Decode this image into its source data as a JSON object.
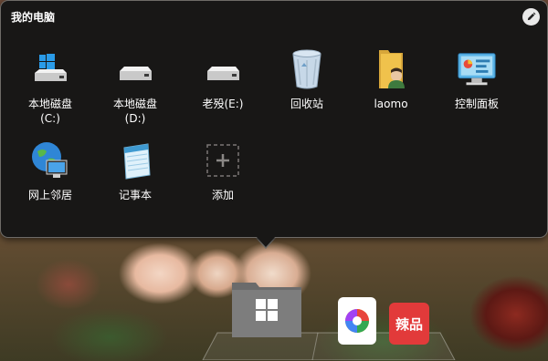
{
  "panel": {
    "title": "我的电脑",
    "edit_icon": "pencil-icon"
  },
  "items": [
    {
      "id": "drive-c",
      "label": "本地磁盘",
      "sublabel": "(C:)",
      "icon": "windows-drive-icon"
    },
    {
      "id": "drive-d",
      "label": "本地磁盘",
      "sublabel": "(D:)",
      "icon": "drive-icon"
    },
    {
      "id": "drive-e",
      "label": "老殁(E:)",
      "sublabel": "",
      "icon": "drive-icon"
    },
    {
      "id": "recycle-bin",
      "label": "回收站",
      "sublabel": "",
      "icon": "recycle-bin-icon"
    },
    {
      "id": "laomo",
      "label": "laomo",
      "sublabel": "",
      "icon": "user-folder-icon"
    },
    {
      "id": "control-panel",
      "label": "控制面板",
      "sublabel": "",
      "icon": "control-panel-icon"
    },
    {
      "id": "network",
      "label": "网上邻居",
      "sublabel": "",
      "icon": "network-globe-icon"
    },
    {
      "id": "notepad",
      "label": "记事本",
      "sublabel": "",
      "icon": "notepad-icon"
    },
    {
      "id": "add",
      "label": "添加",
      "sublabel": "",
      "icon": "add-icon"
    }
  ],
  "taskbar": {
    "folder_icon": "windows-folder-icon",
    "apps": [
      {
        "name": "color-wheel-app-icon",
        "color": "#ffffff"
      },
      {
        "name": "lapin-app-icon",
        "label": "辣品",
        "color": "#e23a3a"
      }
    ]
  },
  "colors": {
    "panel_bg": "#181716",
    "panel_border": "#6e6b67",
    "text": "#ffffff"
  }
}
